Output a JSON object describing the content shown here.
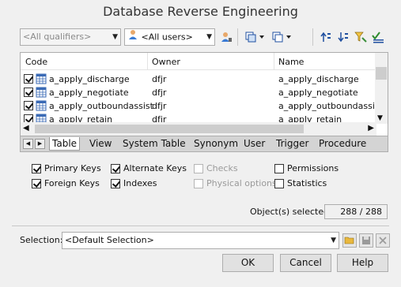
{
  "window": {
    "title": "Database Reverse Engineering"
  },
  "toolbar": {
    "qualifier_value": "<All qualifiers>",
    "owner_value": "<All users>"
  },
  "list": {
    "columns": [
      "Code",
      "Owner",
      "Name"
    ],
    "rows": [
      {
        "checked": true,
        "code": "a_apply_discharge",
        "owner": "dfjr",
        "name": "a_apply_discharge"
      },
      {
        "checked": true,
        "code": "a_apply_negotiate",
        "owner": "dfjr",
        "name": "a_apply_negotiate"
      },
      {
        "checked": true,
        "code": "a_apply_outboundassist",
        "owner": "dfjr",
        "name": "a_apply_outboundassist"
      },
      {
        "checked": true,
        "code": "a_apply_retain",
        "owner": "dfjr",
        "name": "a_apply_retain"
      }
    ]
  },
  "tabs": [
    "Table",
    "View",
    "System Table",
    "Synonym",
    "User",
    "Trigger",
    "Procedure"
  ],
  "active_tab": "Table",
  "options": {
    "primary_keys": "Primary Keys",
    "foreign_keys": "Foreign Keys",
    "alternate_keys": "Alternate Keys",
    "indexes": "Indexes",
    "checks": "Checks",
    "physical_options": "Physical options",
    "permissions": "Permissions",
    "statistics": "Statistics"
  },
  "status": {
    "label": "Object(s) selected:",
    "value": "288 / 288"
  },
  "selection": {
    "label": "Selection:",
    "value": "<Default Selection>"
  },
  "buttons": {
    "ok": "OK",
    "cancel": "Cancel",
    "help": "Help"
  },
  "colors": {
    "accent": "#1f6fc5",
    "window_bg": "#f0f0f0",
    "tab_bar": "#d4d4d4"
  },
  "icons": [
    "user-icon",
    "owner-icon",
    "select-all-icon",
    "deselect-all-icon",
    "move-up-icon",
    "move-down-icon",
    "filter-icon",
    "check-filter-icon",
    "table-icon",
    "open-folder-icon",
    "save-icon",
    "delete-icon"
  ]
}
